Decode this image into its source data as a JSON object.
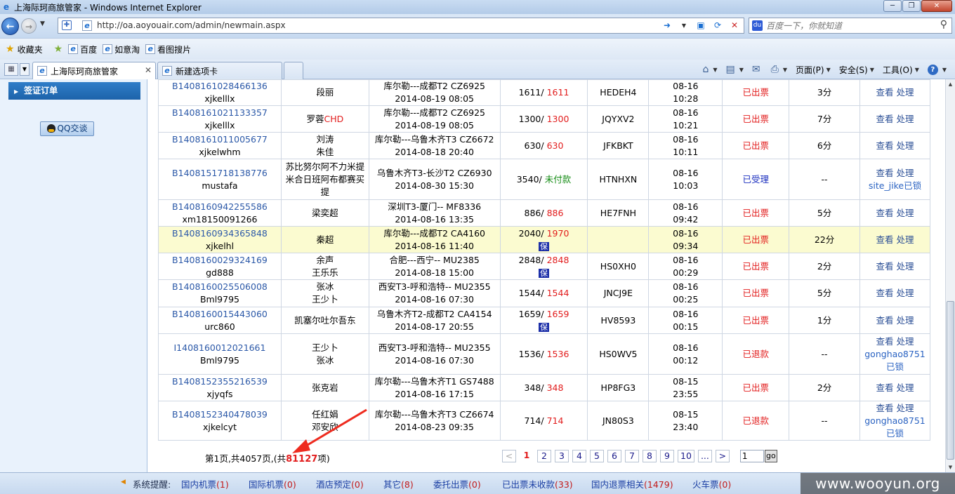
{
  "window": {
    "title": "上海际珂商旅管家 - Windows Internet Explorer"
  },
  "address_bar": {
    "url": "http://oa.aoyouair.com/admin/newmain.aspx",
    "search_placeholder": "百度一下，你就知道"
  },
  "favorites": {
    "label": "收藏夹",
    "items": [
      "百度",
      "如意淘",
      "看图搜片"
    ]
  },
  "tabs": {
    "active_label": "上海际珂商旅管家",
    "new_label": "新建选项卡"
  },
  "command_bar": {
    "page": "页面(P)",
    "safety": "安全(S)",
    "tools": "工具(O)"
  },
  "sidebar": {
    "visa_orders": "签证订单",
    "qq_chat": "QQ交谈"
  },
  "orders": [
    {
      "id": "B1408161028466136",
      "user": "xjkelllx",
      "pax": [
        "段丽"
      ],
      "route": "库尔勒---成都T2 CZ6925",
      "date": "2014-08-19 08:05",
      "price_a": "1611/",
      "price_b": "1611",
      "price_b_color": "red",
      "bao": "",
      "pnr": "HEDEH4",
      "t1": "08-16",
      "t2": "10:28",
      "status": "已出票",
      "status_color": "red",
      "dur": "3分",
      "ops": "查看 处理",
      "lock": ""
    },
    {
      "id": "B1408161021133357",
      "user": "xjkelllx",
      "pax": [
        "罗蓉"
      ],
      "pax_tag": "CHD",
      "route": "库尔勒---成都T2 CZ6925",
      "date": "2014-08-19 08:05",
      "price_a": "1300/",
      "price_b": "1300",
      "price_b_color": "red",
      "bao": "",
      "pnr": "JQYXV2",
      "t1": "08-16",
      "t2": "10:21",
      "status": "已出票",
      "status_color": "red",
      "dur": "7分",
      "ops": "查看 处理",
      "lock": ""
    },
    {
      "id": "B1408161011005677",
      "user": "xjkelwhm",
      "pax": [
        "刘涛",
        "朱佳"
      ],
      "route": "库尔勒---乌鲁木齐T3 CZ6672",
      "date": "2014-08-18 20:40",
      "price_a": "630/",
      "price_b": "630",
      "price_b_color": "red",
      "bao": "",
      "pnr": "JFKBKT",
      "t1": "08-16",
      "t2": "10:11",
      "status": "已出票",
      "status_color": "red",
      "dur": "6分",
      "ops": "查看 处理",
      "lock": ""
    },
    {
      "id": "B1408151718138776",
      "user": "mustafa",
      "pax": [
        "苏比努尔阿不力米提",
        "米合日班阿布都赛买",
        "提"
      ],
      "route": "乌鲁木齐T3-长沙T2 CZ6930",
      "date": "2014-08-30 15:30",
      "price_a": "3540/",
      "price_b": "未付款",
      "price_b_color": "green",
      "bao": "",
      "pnr": "HTNHXN",
      "t1": "08-16",
      "t2": "10:03",
      "status": "已受理",
      "status_color": "blue",
      "dur": "--",
      "ops": "查看 处理",
      "lock": "site_jike已锁"
    },
    {
      "id": "B1408160942255586",
      "user": "xm18150091266",
      "pax": [
        "梁奕超"
      ],
      "route": "深圳T3-厦门-- MF8336",
      "date": "2014-08-16 13:35",
      "price_a": "886/",
      "price_b": "886",
      "price_b_color": "red",
      "bao": "",
      "pnr": "HE7FNH",
      "t1": "08-16",
      "t2": "09:42",
      "status": "已出票",
      "status_color": "red",
      "dur": "5分",
      "ops": "查看 处理",
      "lock": ""
    },
    {
      "id": "B1408160934365848",
      "user": "xjkelhl",
      "pax": [
        "秦超"
      ],
      "route": "库尔勒---成都T2 CA4160",
      "date": "2014-08-16 11:40",
      "price_a": "2040/",
      "price_b": "1970",
      "price_b_color": "red",
      "bao": "保",
      "pnr": "",
      "t1": "08-16",
      "t2": "09:34",
      "status": "已出票",
      "status_color": "red",
      "dur": "22分",
      "ops": "查看 处理",
      "lock": "",
      "highlight": true
    },
    {
      "id": "B1408160029324169",
      "user": "gd888",
      "pax": [
        "余声",
        "王乐乐"
      ],
      "route": "合肥---西宁-- MU2385",
      "date": "2014-08-18 15:00",
      "price_a": "2848/",
      "price_b": "2848",
      "price_b_color": "red",
      "bao": "保",
      "pnr": "HS0XH0",
      "t1": "08-16",
      "t2": "00:29",
      "status": "已出票",
      "status_color": "red",
      "dur": "2分",
      "ops": "查看 处理",
      "lock": ""
    },
    {
      "id": "B1408160025506008",
      "user": "Bml9795",
      "pax": [
        "张冰",
        "王少卜"
      ],
      "route": "西安T3-呼和浩特-- MU2355",
      "date": "2014-08-16 07:30",
      "price_a": "1544/",
      "price_b": "1544",
      "price_b_color": "red",
      "bao": "",
      "pnr": "JNCJ9E",
      "t1": "08-16",
      "t2": "00:25",
      "status": "已出票",
      "status_color": "red",
      "dur": "5分",
      "ops": "查看 处理",
      "lock": ""
    },
    {
      "id": "B1408160015443060",
      "user": "urc860",
      "pax": [
        "凯塞尔吐尔吾东"
      ],
      "route": "乌鲁木齐T2-成都T2 CA4154",
      "date": "2014-08-17 20:55",
      "price_a": "1659/",
      "price_b": "1659",
      "price_b_color": "red",
      "bao": "保",
      "pnr": "HV8593",
      "t1": "08-16",
      "t2": "00:15",
      "status": "已出票",
      "status_color": "red",
      "dur": "1分",
      "ops": "查看 处理",
      "lock": ""
    },
    {
      "id": "I1408160012021661",
      "user": "Bml9795",
      "pax": [
        "王少卜",
        "张冰"
      ],
      "route": "西安T3-呼和浩特-- MU2355",
      "date": "2014-08-16 07:30",
      "price_a": "1536/",
      "price_b": "1536",
      "price_b_color": "red",
      "bao": "",
      "pnr": "HS0WV5",
      "t1": "08-16",
      "t2": "00:12",
      "status": "已退款",
      "status_color": "red",
      "dur": "--",
      "ops": "查看 处理",
      "lock": "gonghao8751 已锁"
    },
    {
      "id": "B1408152355216539",
      "user": "xjyqfs",
      "pax": [
        "张克岩"
      ],
      "route": "库尔勒---乌鲁木齐T1 GS7488",
      "date": "2014-08-16 17:15",
      "price_a": "348/",
      "price_b": "348",
      "price_b_color": "red",
      "bao": "",
      "pnr": "HP8FG3",
      "t1": "08-15",
      "t2": "23:55",
      "status": "已出票",
      "status_color": "red",
      "dur": "2分",
      "ops": "查看 处理",
      "lock": ""
    },
    {
      "id": "B1408152340478039",
      "user": "xjkelcyt",
      "pax": [
        "任红娟",
        "邓安欣"
      ],
      "route": "库尔勒---乌鲁木齐T3 CZ6674",
      "date": "2014-08-23 09:35",
      "price_a": "714/",
      "price_b": "714",
      "price_b_color": "red",
      "bao": "",
      "pnr": "JN80S3",
      "t1": "08-15",
      "t2": "23:40",
      "status": "已退款",
      "status_color": "red",
      "dur": "--",
      "ops": "查看 处理",
      "lock": "gonghao8751 已锁"
    }
  ],
  "pager": {
    "info_prefix": "第1页,共4057页,(共",
    "total": "81127",
    "info_suffix": "项)",
    "prev": "<",
    "next": ">",
    "pages": [
      "1",
      "2",
      "3",
      "4",
      "5",
      "6",
      "7",
      "8",
      "9",
      "10",
      "..."
    ],
    "current": "1",
    "input_value": "1",
    "go": "go"
  },
  "reminders": {
    "label": "系统提醒:",
    "items": [
      {
        "name": "国内机票",
        "count": "(1)"
      },
      {
        "name": "国际机票",
        "count": "(0)"
      },
      {
        "name": "酒店预定",
        "count": "(0)"
      },
      {
        "name": "其它",
        "count": "(8)"
      },
      {
        "name": "委托出票",
        "count": "(0)"
      },
      {
        "name": "已出票未收款",
        "count": "(33)"
      },
      {
        "name": "国内退票相关",
        "count": "(1479)"
      },
      {
        "name": "火车票",
        "count": "(0)"
      }
    ]
  },
  "watermark": "www.wooyun.org"
}
